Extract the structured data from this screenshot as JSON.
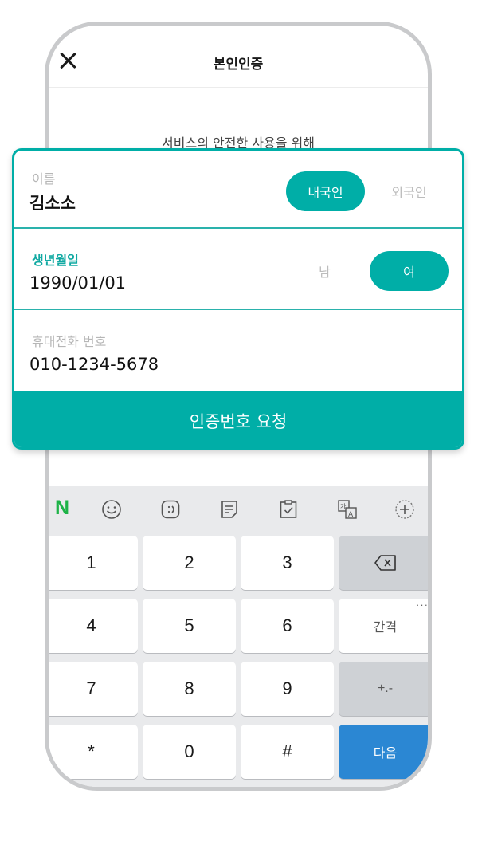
{
  "header": {
    "title": "본인인증",
    "close_icon": "close-icon"
  },
  "subtitle": "서비스의 안전한 사용을 위해",
  "form": {
    "name": {
      "label": "이름",
      "value": "김소소"
    },
    "nationality": {
      "options": [
        "내국인",
        "외국인"
      ],
      "selected": "내국인"
    },
    "birth": {
      "label": "생년월일",
      "value": "1990/01/01"
    },
    "gender": {
      "options": [
        "남",
        "여"
      ],
      "selected": "여"
    },
    "phone": {
      "label": "휴대전화 번호",
      "value": "010-1234-5678"
    },
    "submit_label": "인증번호 요청"
  },
  "keyboard": {
    "toolbar": {
      "brand": "N",
      "icons": [
        "emoji-icon",
        "emoticon-icon",
        "memo-icon",
        "clipboard-icon",
        "translate-icon",
        "add-icon"
      ]
    },
    "keys": [
      "1",
      "2",
      "3",
      "4",
      "5",
      "6",
      "7",
      "8",
      "9",
      "*",
      "0",
      "#"
    ],
    "backspace_icon": "backspace-icon",
    "space_label": "간격",
    "space_more": "···",
    "symbol_label": "+.-",
    "next_label": "다음"
  },
  "colors": {
    "accent": "#00aea7",
    "next_key": "#2b87d3",
    "brand": "#1db347"
  }
}
